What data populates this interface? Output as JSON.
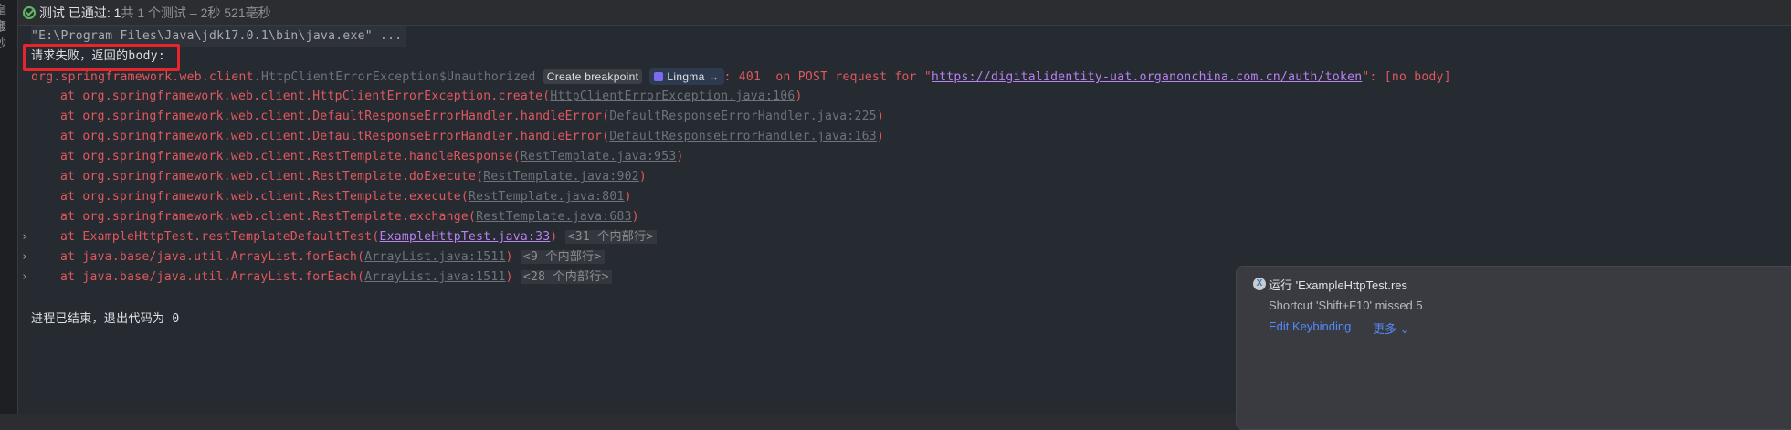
{
  "gutter": {
    "items": [
      "毫秒",
      "毫秒"
    ]
  },
  "header": {
    "status": "测试 已通过: 1",
    "summary": "共 1 个测试 – 2秒 521毫秒"
  },
  "console": {
    "command": "\"E:\\Program Files\\Java\\jdk17.0.1\\bin\\java.exe\" ...",
    "message": "请求失败，返回的body:",
    "exception_pkg": "org.springframework.web.client.",
    "exception_class": "HttpClientErrorException$Unauthorized",
    "create_breakpoint": "Create breakpoint",
    "lingma": "Lingma →",
    "exception_msg_pre": ": 401  on POST request for \"",
    "exception_url": "https://digitalidentity-uat.organonchina.com.cn/auth/token",
    "exception_msg_post": "\": [no body]",
    "frames": [
      {
        "text": "at org.springframework.web.client.HttpClientErrorException.create(",
        "link": "HttpClientErrorException.java:106",
        "tail": ")"
      },
      {
        "text": "at org.springframework.web.client.DefaultResponseErrorHandler.handleError(",
        "link": "DefaultResponseErrorHandler.java:225",
        "tail": ")"
      },
      {
        "text": "at org.springframework.web.client.DefaultResponseErrorHandler.handleError(",
        "link": "DefaultResponseErrorHandler.java:163",
        "tail": ")"
      },
      {
        "text": "at org.springframework.web.client.RestTemplate.handleResponse(",
        "link": "RestTemplate.java:953",
        "tail": ")"
      },
      {
        "text": "at org.springframework.web.client.RestTemplate.doExecute(",
        "link": "RestTemplate.java:902",
        "tail": ")"
      },
      {
        "text": "at org.springframework.web.client.RestTemplate.execute(",
        "link": "RestTemplate.java:801",
        "tail": ")"
      },
      {
        "text": "at org.springframework.web.client.RestTemplate.exchange(",
        "link": "RestTemplate.java:683",
        "tail": ")"
      },
      {
        "text": "at ExampleHttpTest.restTemplateDefaultTest(",
        "link": "ExampleHttpTest.java:33",
        "tail": ")",
        "fold": "<31 个内部行>"
      },
      {
        "text": "at java.base/java.util.ArrayList.forEach(",
        "link": "ArrayList.java:1511",
        "tail": ")",
        "fold": "<9 个内部行>"
      },
      {
        "text": "at java.base/java.util.ArrayList.forEach(",
        "link": "ArrayList.java:1511",
        "tail": ")",
        "fold": "<28 个内部行>"
      }
    ],
    "exit": "进程已结束，退出代码为 0"
  },
  "notification": {
    "title": "运行 'ExampleHttpTest.res",
    "body": "Shortcut 'Shift+F10' missed 5",
    "action": "Edit Keybinding",
    "more": "更多 ⌄"
  }
}
